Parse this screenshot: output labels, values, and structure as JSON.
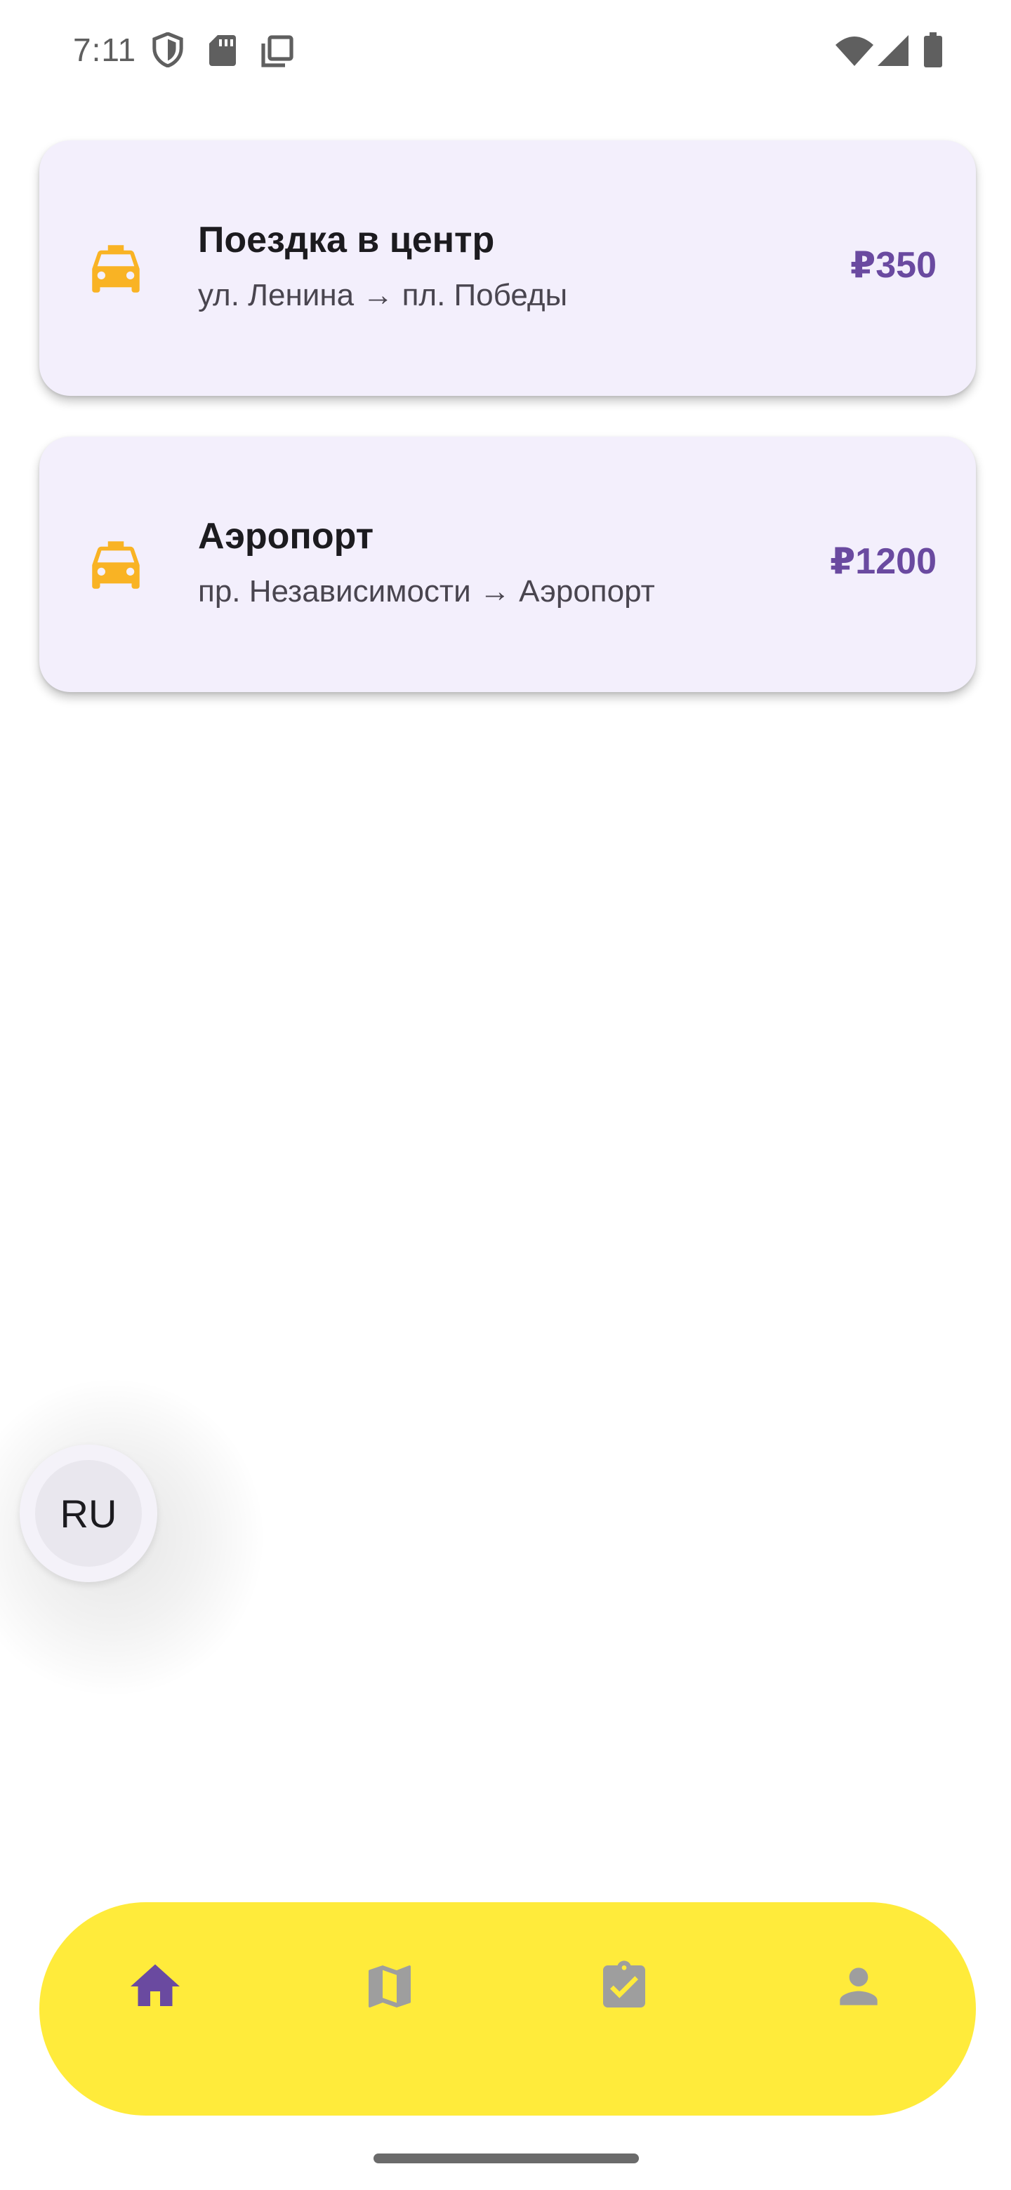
{
  "status_bar": {
    "time": "7:11",
    "left_icons": [
      "shield-icon",
      "sd-card-icon",
      "copy-icon"
    ],
    "right_icons": [
      "wifi-icon",
      "cell-signal-icon",
      "battery-icon"
    ]
  },
  "trips": [
    {
      "icon": "taxi-icon",
      "title": "Поездка в центр",
      "route": "ул. Ленина → пл. Победы",
      "price": "₽350"
    },
    {
      "icon": "taxi-icon",
      "title": "Аэропорт",
      "route": "пр. Независимости → Аэропорт",
      "price": "₽1200"
    }
  ],
  "language_button": {
    "label": "RU"
  },
  "bottom_nav": {
    "items": [
      {
        "icon": "home-icon",
        "selected": true
      },
      {
        "icon": "map-icon",
        "selected": false
      },
      {
        "icon": "clipboard-check-icon",
        "selected": false
      },
      {
        "icon": "person-icon",
        "selected": false
      }
    ]
  },
  "colors": {
    "card_background": "#f3effc",
    "price": "#6a4aa0",
    "taxi": "#f9b324",
    "nav_background": "#ffeb3b",
    "nav_selected": "#6a4aa0",
    "nav_unselected": "#9e9e9e"
  }
}
